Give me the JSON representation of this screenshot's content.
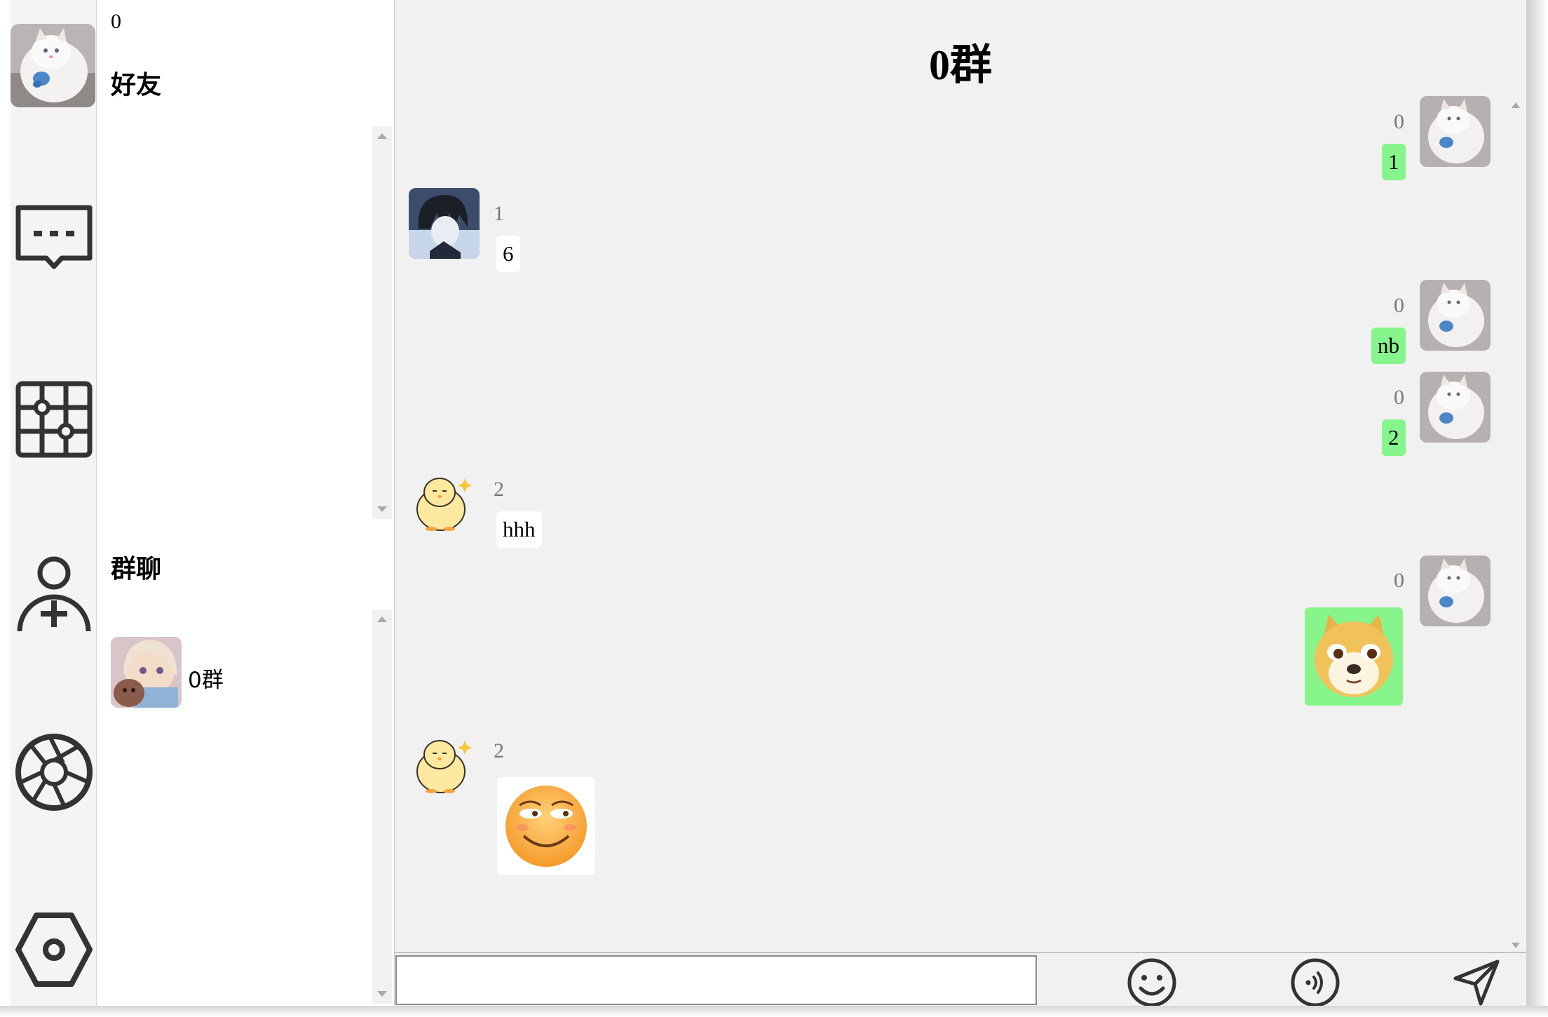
{
  "sidebar": {
    "user_avatar": "white-cat-avatar",
    "items": [
      {
        "name": "chat",
        "icon": "chat-bubble-icon"
      },
      {
        "name": "apps",
        "icon": "grid-icon"
      },
      {
        "name": "add-friend",
        "icon": "add-user-icon"
      },
      {
        "name": "moments",
        "icon": "aperture-icon"
      },
      {
        "name": "settings",
        "icon": "hexagon-settings-icon"
      }
    ]
  },
  "contacts": {
    "me_name": "0",
    "friends_title": "好友",
    "groups_title": "群聊",
    "groups": [
      {
        "name": "0群",
        "avatar": "anime-girl-avatar"
      }
    ]
  },
  "chat": {
    "title": "0群",
    "messages": [
      {
        "sender": "0",
        "text": "1",
        "mine": true
      },
      {
        "sender": "1",
        "text": "6",
        "mine": false
      },
      {
        "sender": "0",
        "text": "nb",
        "mine": true
      },
      {
        "sender": "0",
        "text": "2",
        "mine": true
      },
      {
        "sender": "2",
        "text": "hhh",
        "mine": false
      },
      {
        "sender": "0",
        "sticker": "doge-sticker",
        "mine": true
      },
      {
        "sender": "2",
        "sticker": "smirk-emoji-sticker",
        "mine": false
      }
    ]
  },
  "inputbar": {
    "placeholder": "",
    "value": "",
    "icons": [
      "emoji-icon",
      "voice-icon",
      "send-icon"
    ]
  },
  "colors": {
    "my_bubble": "#86f58c",
    "their_bubble": "#ffffff",
    "chat_bg": "#f1f1f1",
    "icon_dark": "#333333"
  }
}
